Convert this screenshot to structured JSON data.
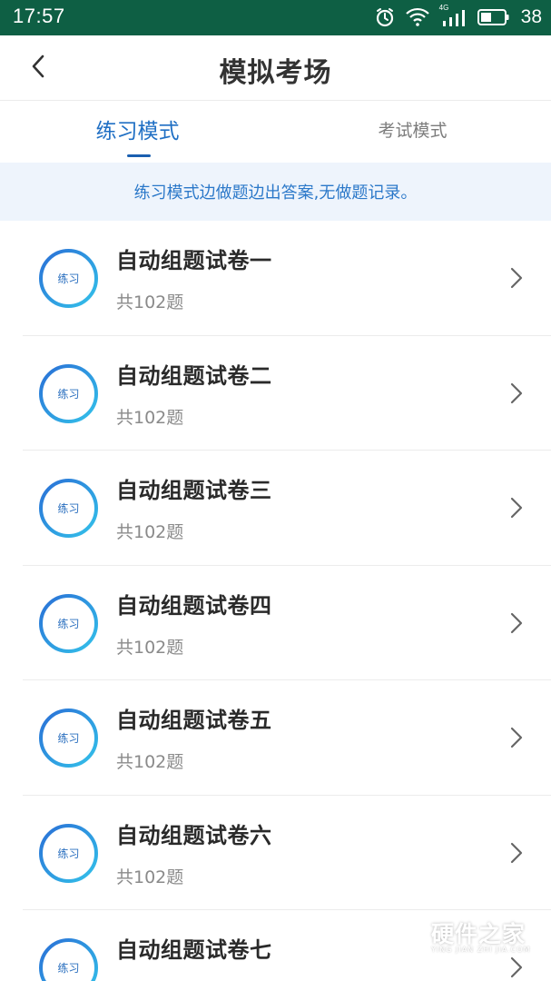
{
  "status_bar": {
    "time": "17:57",
    "battery_percent": "38",
    "network_label": "4G",
    "icons": [
      "alarm-icon",
      "wifi-icon",
      "signal-icon",
      "battery-icon"
    ],
    "background_color": "#0e5f44"
  },
  "header": {
    "title": "模拟考场",
    "back_icon": "chevron-left-icon"
  },
  "tabs": [
    {
      "label": "练习模式",
      "active": true
    },
    {
      "label": "考试模式",
      "active": false
    }
  ],
  "notice": {
    "text": "练习模式边做题边出答案,无做题记录。"
  },
  "exam_list": [
    {
      "badge": "练习",
      "title": "自动组题试卷一",
      "count": "共102题"
    },
    {
      "badge": "练习",
      "title": "自动组题试卷二",
      "count": "共102题"
    },
    {
      "badge": "练习",
      "title": "自动组题试卷三",
      "count": "共102题"
    },
    {
      "badge": "练习",
      "title": "自动组题试卷四",
      "count": "共102题"
    },
    {
      "badge": "练习",
      "title": "自动组题试卷五",
      "count": "共102题"
    },
    {
      "badge": "练习",
      "title": "自动组题试卷六",
      "count": "共102题"
    },
    {
      "badge": "练习",
      "title": "自动组题试卷七",
      "count": ""
    }
  ],
  "watermark": {
    "text": "硬件之家",
    "subtext": "YING JIAN ZHI JIA.COM"
  },
  "colors": {
    "accent": "#1f6fc4",
    "notice_bg": "#eef4fc",
    "ring_start": "#2a6fd6",
    "ring_end": "#33c2ea"
  }
}
